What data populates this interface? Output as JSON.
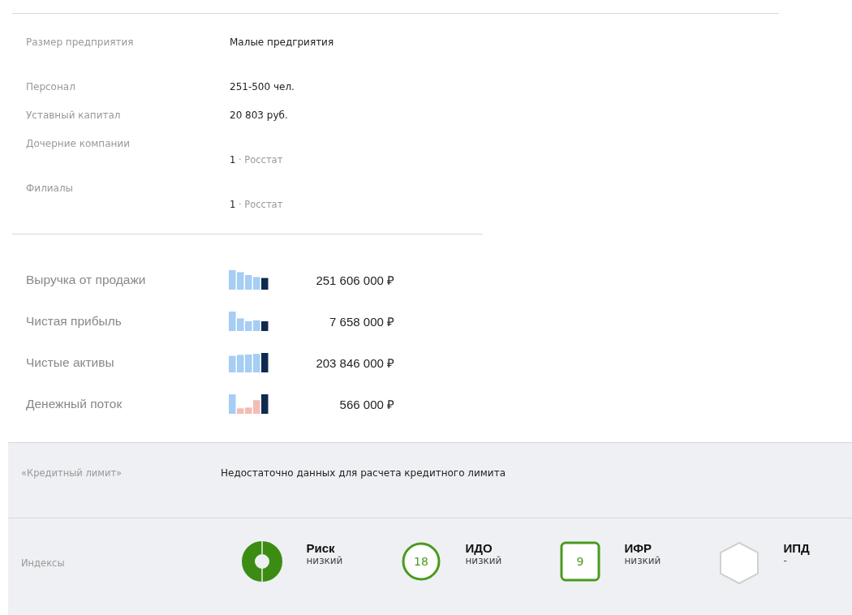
{
  "details": [
    {
      "label": "Размер предприятия",
      "value": "Малые предгриятия",
      "kind": "plain"
    },
    {
      "label": "Персонал",
      "value": "251-500 чел.",
      "kind": "plain"
    },
    {
      "label": "Уставный капитал",
      "value": "20 803 руб.",
      "kind": "plain"
    },
    {
      "label": "Дочерние компании",
      "value": "1",
      "separator": "·",
      "source": "Росстат",
      "kind": "sourced"
    },
    {
      "label": "Филиалы",
      "value": "1",
      "separator": "·",
      "source": "Росстат",
      "kind": "sourced"
    }
  ],
  "finances": [
    {
      "label": "Выручка от продажи",
      "amount": "251 606 000 ₽",
      "kind": "sparkline"
    },
    {
      "label": "Чистая прибыль",
      "amount": "7 658 000 ₽",
      "kind": "sparkline"
    },
    {
      "label": "Чистые активы",
      "amount": "203 846 000 ₽",
      "kind": "sparkline"
    },
    {
      "label": "Денежный поток",
      "amount": "566 000 ₽",
      "kind": "sparkline"
    }
  ],
  "credit_limit": {
    "label": "«Кредитный лимит»",
    "text": "Недостаточно данных для расчета кредитного лимита"
  },
  "indexes": {
    "label": "Индексы",
    "items": [
      {
        "kind": "donut",
        "name": "Риск",
        "rating": "низкий"
      },
      {
        "kind": "circle",
        "value": "18",
        "name": "ИДО",
        "rating": "низкий"
      },
      {
        "kind": "square",
        "value": "9",
        "name": "ИФР",
        "rating": "низкий"
      },
      {
        "kind": "hexagon",
        "name": "ИПД",
        "rating": "-"
      }
    ]
  }
}
